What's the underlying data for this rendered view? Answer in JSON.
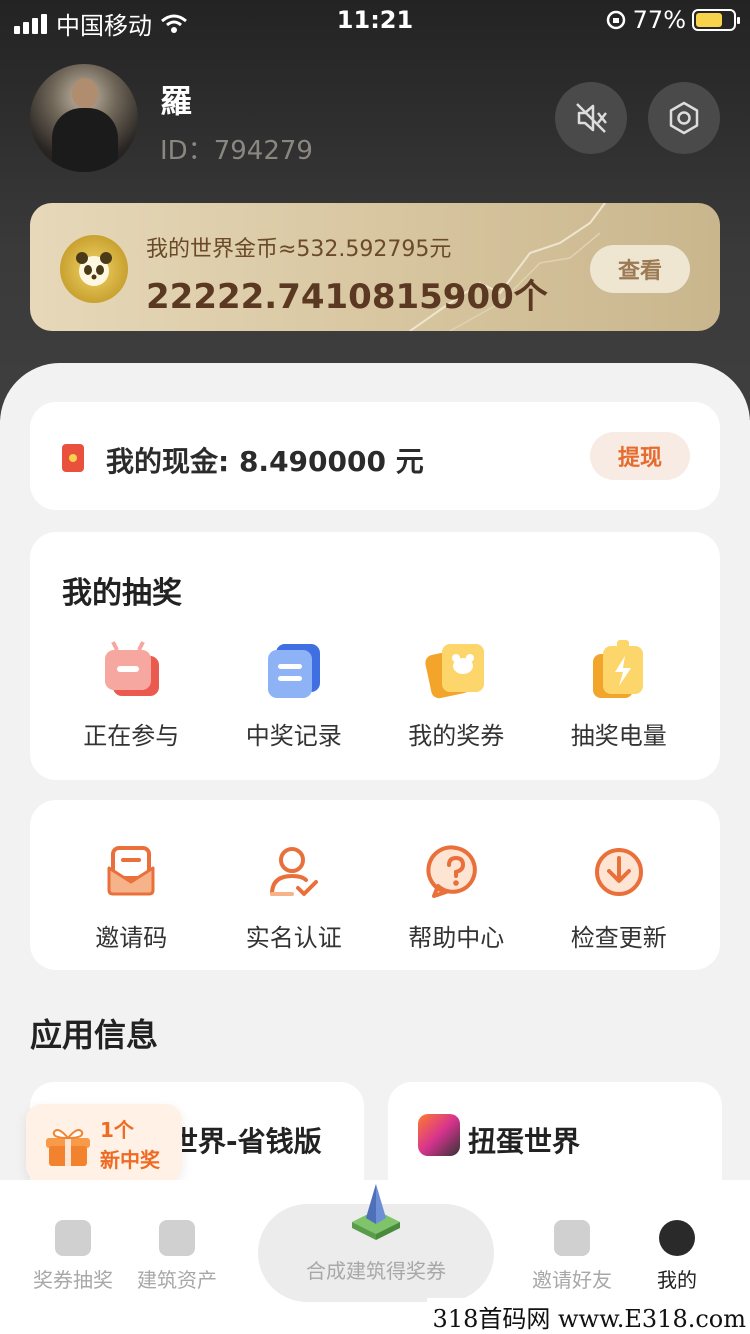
{
  "status_bar": {
    "carrier": "中国移动",
    "time": "11:21",
    "battery_percent": "77%",
    "battery_level": 0.77
  },
  "profile": {
    "username": "羅",
    "user_id": "ID：794279",
    "icons": [
      "mute-icon",
      "settings-icon"
    ]
  },
  "gold": {
    "rate_text": "我的世界金币≈532.592795元",
    "amount": "22222.7410815900个",
    "view_label": "查看"
  },
  "cash": {
    "label": "我的现金: 8.490000 元",
    "withdraw_label": "提现"
  },
  "lottery": {
    "title": "我的抽奖",
    "items": [
      {
        "label": "正在参与",
        "icon": "participating-icon"
      },
      {
        "label": "中奖记录",
        "icon": "win-record-icon"
      },
      {
        "label": "我的奖券",
        "icon": "ticket-icon"
      },
      {
        "label": "抽奖电量",
        "icon": "energy-icon"
      }
    ]
  },
  "tools": {
    "items": [
      {
        "label": "邀请码",
        "icon": "invite-code-icon"
      },
      {
        "label": "实名认证",
        "icon": "verify-icon"
      },
      {
        "label": "帮助中心",
        "icon": "help-icon"
      },
      {
        "label": "检查更新",
        "icon": "update-icon"
      }
    ]
  },
  "app_info": {
    "title": "应用信息",
    "apps": [
      {
        "name": "世界-省钱版"
      },
      {
        "name": "扭蛋世界"
      }
    ],
    "prize_float": {
      "count": "1个",
      "text": "新中奖"
    }
  },
  "tab_bar": {
    "tabs": [
      {
        "label": "奖券抽奖",
        "icon": "lottery-tab-icon"
      },
      {
        "label": "建筑资产",
        "icon": "building-assets-icon"
      },
      {
        "label": "合成建筑得奖券",
        "icon": "building-icon"
      },
      {
        "label": "邀请好友",
        "icon": "invite-friends-icon"
      },
      {
        "label": "我的",
        "icon": "profile-tab-icon"
      }
    ]
  },
  "watermark": "318首码网 www.E318.com",
  "colors": {
    "accent": "#ef6a22",
    "gold_text": "#5a3822",
    "cash_icon": "#e9513c"
  }
}
